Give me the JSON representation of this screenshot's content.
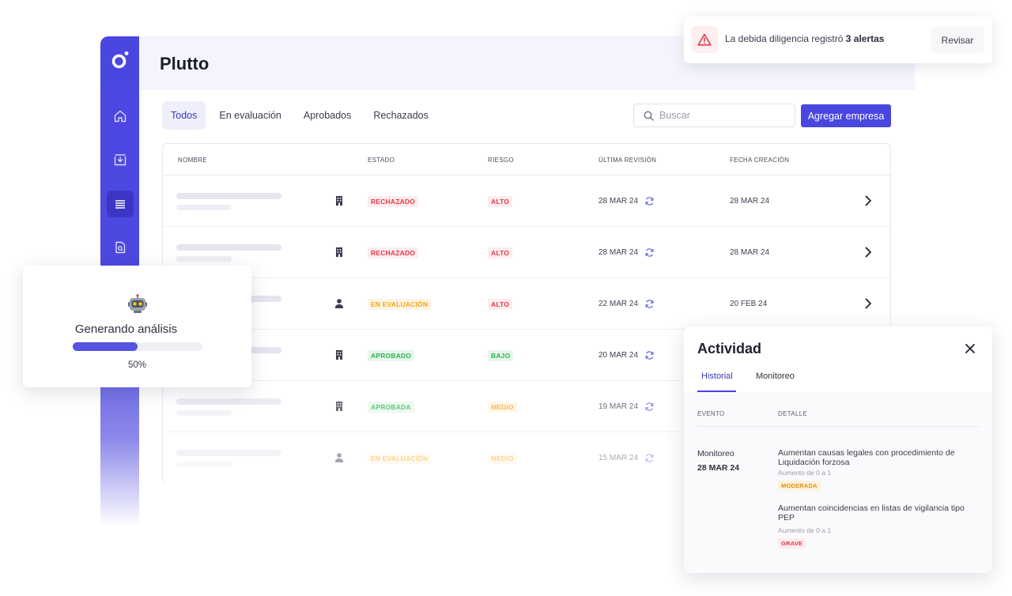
{
  "app": {
    "title": "Plutto"
  },
  "sidebar": {
    "items": [
      {
        "icon": "home-icon"
      },
      {
        "icon": "inbox-icon"
      },
      {
        "icon": "list-icon",
        "active": true
      },
      {
        "icon": "document-search-icon"
      }
    ]
  },
  "tabs": [
    {
      "label": "Todos",
      "active": true
    },
    {
      "label": "En evaluación"
    },
    {
      "label": "Aprobados"
    },
    {
      "label": "Rechazados"
    }
  ],
  "search": {
    "placeholder": "Buscar"
  },
  "add_button": "Agregar empresa",
  "table": {
    "headers": [
      "NOMBRE",
      "ESTADO",
      "RIESGO",
      "ÚLTIMA REVISIÓN",
      "FECHA CREACIÓN"
    ],
    "rows": [
      {
        "type": "building-icon",
        "estado": "RECHAZADO",
        "estado_color": "red",
        "riesgo": "ALTO",
        "riesgo_color": "red",
        "ultima": "28 MAR 24",
        "creacion": "28 MAR 24"
      },
      {
        "type": "building-icon",
        "estado": "RECHAZADO",
        "estado_color": "red",
        "riesgo": "ALTO",
        "riesgo_color": "red",
        "ultima": "28 MAR 24",
        "creacion": "28 MAR 24"
      },
      {
        "type": "person-icon",
        "estado": "EN EVALUACIÓN",
        "estado_color": "orange",
        "riesgo": "ALTO",
        "riesgo_color": "red",
        "ultima": "22 MAR 24",
        "creacion": "20 FEB 24"
      },
      {
        "type": "building-icon",
        "estado": "APROBADO",
        "estado_color": "green",
        "riesgo": "BAJO",
        "riesgo_color": "green",
        "ultima": "20 MAR 24",
        "creacion": ""
      },
      {
        "type": "building-icon",
        "estado": "APROBADA",
        "estado_color": "green",
        "riesgo": "MEDIO",
        "riesgo_color": "orange",
        "ultima": "19 MAR 24",
        "creacion": ""
      },
      {
        "type": "person-icon",
        "estado": "EN EVALUACIÓN",
        "estado_color": "orange",
        "riesgo": "MEDIO",
        "riesgo_color": "orange",
        "ultima": "15 MAR 24",
        "creacion": ""
      }
    ]
  },
  "alert": {
    "text_before": "La debida diligencia registró ",
    "text_bold": "3 alertas",
    "button": "Revisar",
    "icon": "warning-triangle-icon",
    "color": "#e23b4a"
  },
  "progress": {
    "icon": "robot-icon",
    "title": "Generando análisis",
    "percent_label": "50%",
    "fraction": 0.5
  },
  "activity": {
    "title": "Actividad",
    "tabs": [
      {
        "label": "Historial",
        "active": true
      },
      {
        "label": "Monitoreo"
      }
    ],
    "headers": {
      "event": "EVENTO",
      "detail": "DETALLE"
    },
    "event": {
      "name": "Monitoreo",
      "date": "28 MAR 24"
    },
    "details": [
      {
        "title": "Aumentan causas legales con procedimiento de Liquidación forzosa",
        "sub": "Aumento de 0 a 1",
        "badge": "MODERADA",
        "badge_color": "orange"
      },
      {
        "title": "Aumentan coincidencias en listas de vigilancia tipo PEP",
        "sub": "Aumento de 0 a 1",
        "badge": "GRAVE",
        "badge_color": "red"
      }
    ]
  },
  "colors": {
    "accent": "#4a46e0",
    "red": "#e23b4a",
    "orange": "#f2a319",
    "green": "#2eb451"
  }
}
